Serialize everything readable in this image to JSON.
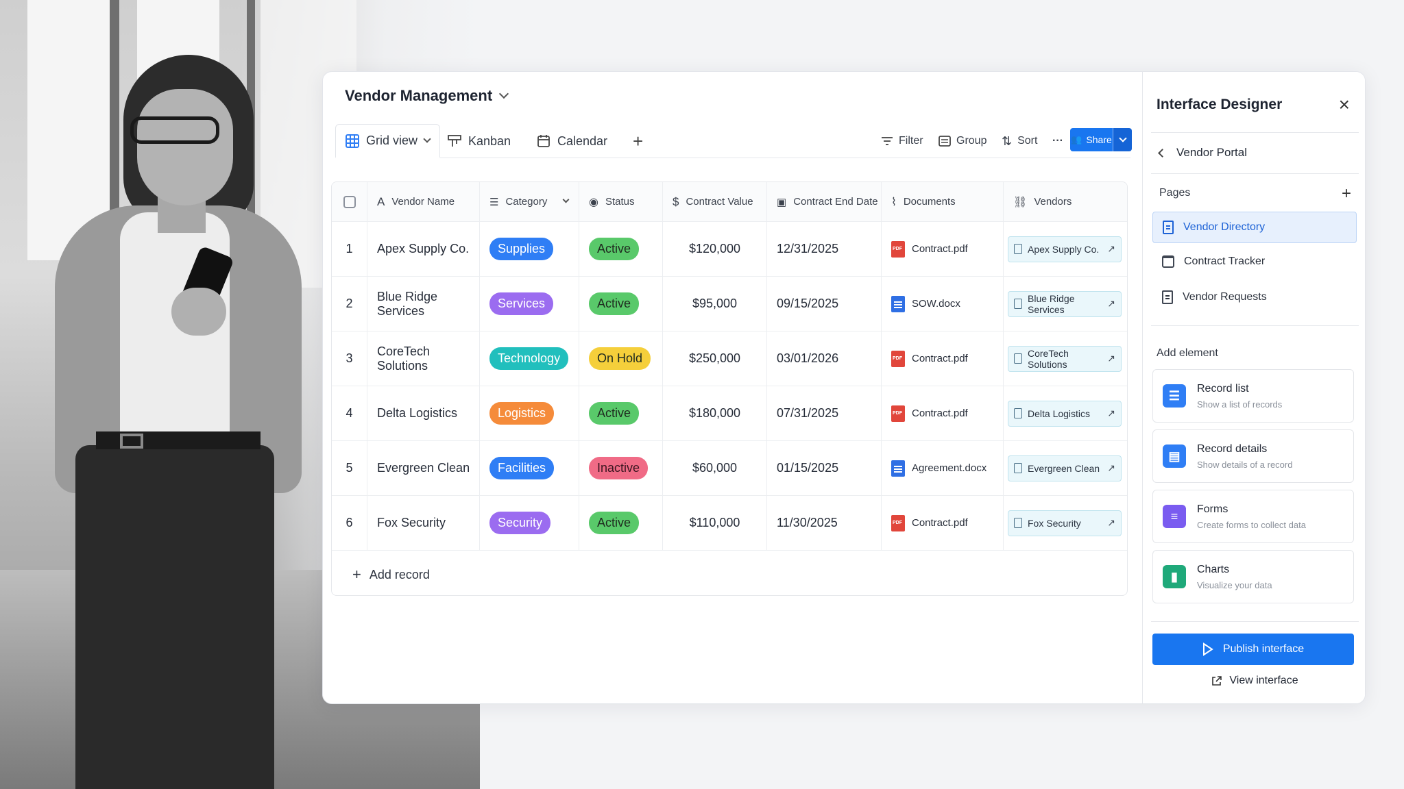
{
  "app": {
    "title": "Vendor Management",
    "views": [
      {
        "label": "Grid view",
        "icon": "grid-icon",
        "active": true
      },
      {
        "label": "Kanban",
        "icon": "kanban-icon"
      },
      {
        "label": "Calendar",
        "icon": "calendar-icon"
      }
    ],
    "add_view": "+",
    "toolbar": {
      "filter": "Filter",
      "group": "Group",
      "sort": "Sort",
      "more": "···",
      "share": "Share"
    }
  },
  "table": {
    "columns": [
      "Vendor Name",
      "Category",
      "Status",
      "Contract Value",
      "Contract End Date",
      "Documents",
      "Vendors"
    ],
    "rows": [
      {
        "num": "1",
        "name": "Apex Supply Co.",
        "category": "Supplies",
        "category_color": "#2f7ef5",
        "status": "Active",
        "status_color": "#59c96a",
        "value": "$120,000",
        "end": "12/31/2025",
        "doc": "Contract.pdf",
        "doc_type": "pdf",
        "vendor": "Apex Supply Co."
      },
      {
        "num": "2",
        "name": "Blue Ridge Services",
        "category": "Services",
        "category_color": "#9b6cf0",
        "status": "Active",
        "status_color": "#59c96a",
        "value": "$95,000",
        "end": "09/15/2025",
        "doc": "SOW.docx",
        "doc_type": "word",
        "vendor": "Blue Ridge Services"
      },
      {
        "num": "3",
        "name": "CoreTech Solutions",
        "category": "Technology",
        "category_color": "#21bfbd",
        "status": "On Hold",
        "status_color": "#f5cf3b",
        "value": "$250,000",
        "end": "03/01/2026",
        "doc": "Contract.pdf",
        "doc_type": "pdf",
        "vendor": "CoreTech Solutions"
      },
      {
        "num": "4",
        "name": "Delta Logistics",
        "category": "Logistics",
        "category_color": "#f58b3a",
        "status": "Active",
        "status_color": "#59c96a",
        "value": "$180,000",
        "end": "07/31/2025",
        "doc": "Contract.pdf",
        "doc_type": "pdf",
        "vendor": "Delta Logistics"
      },
      {
        "num": "5",
        "name": "Evergreen Clean",
        "category": "Facilities",
        "category_color": "#2f7ef5",
        "status": "Inactive",
        "status_color": "#f06b86",
        "value": "$60,000",
        "end": "01/15/2025",
        "doc": "Agreement.docx",
        "doc_type": "word",
        "vendor": "Evergreen Clean"
      },
      {
        "num": "6",
        "name": "Fox Security",
        "category": "Security",
        "category_color": "#9b6cf0",
        "status": "Active",
        "status_color": "#59c96a",
        "value": "$110,000",
        "end": "11/30/2025",
        "doc": "Contract.pdf",
        "doc_type": "pdf",
        "vendor": "Fox Security"
      }
    ],
    "add_record": "Add record"
  },
  "panel": {
    "title": "Interface Designer",
    "back_label": "Vendor Portal",
    "pages_label": "Pages",
    "pages": [
      {
        "label": "Vendor Directory",
        "active": true
      },
      {
        "label": "Contract Tracker"
      },
      {
        "label": "Vendor Requests"
      }
    ],
    "add_element_label": "Add element",
    "elements": [
      {
        "title": "Record list",
        "desc": "Show a list of records",
        "color": "#2f7ef5",
        "icon": "list-icon"
      },
      {
        "title": "Record details",
        "desc": "Show details of a record",
        "color": "#2f7ef5",
        "icon": "details-icon"
      },
      {
        "title": "Forms",
        "desc": "Create forms to collect data",
        "color": "#7a5cf0",
        "icon": "form-icon"
      },
      {
        "title": "Charts",
        "desc": "Visualize your data",
        "color": "#1fa97a",
        "icon": "chart-icon"
      }
    ],
    "publish": "Publish interface",
    "view_interface": "View interface"
  }
}
